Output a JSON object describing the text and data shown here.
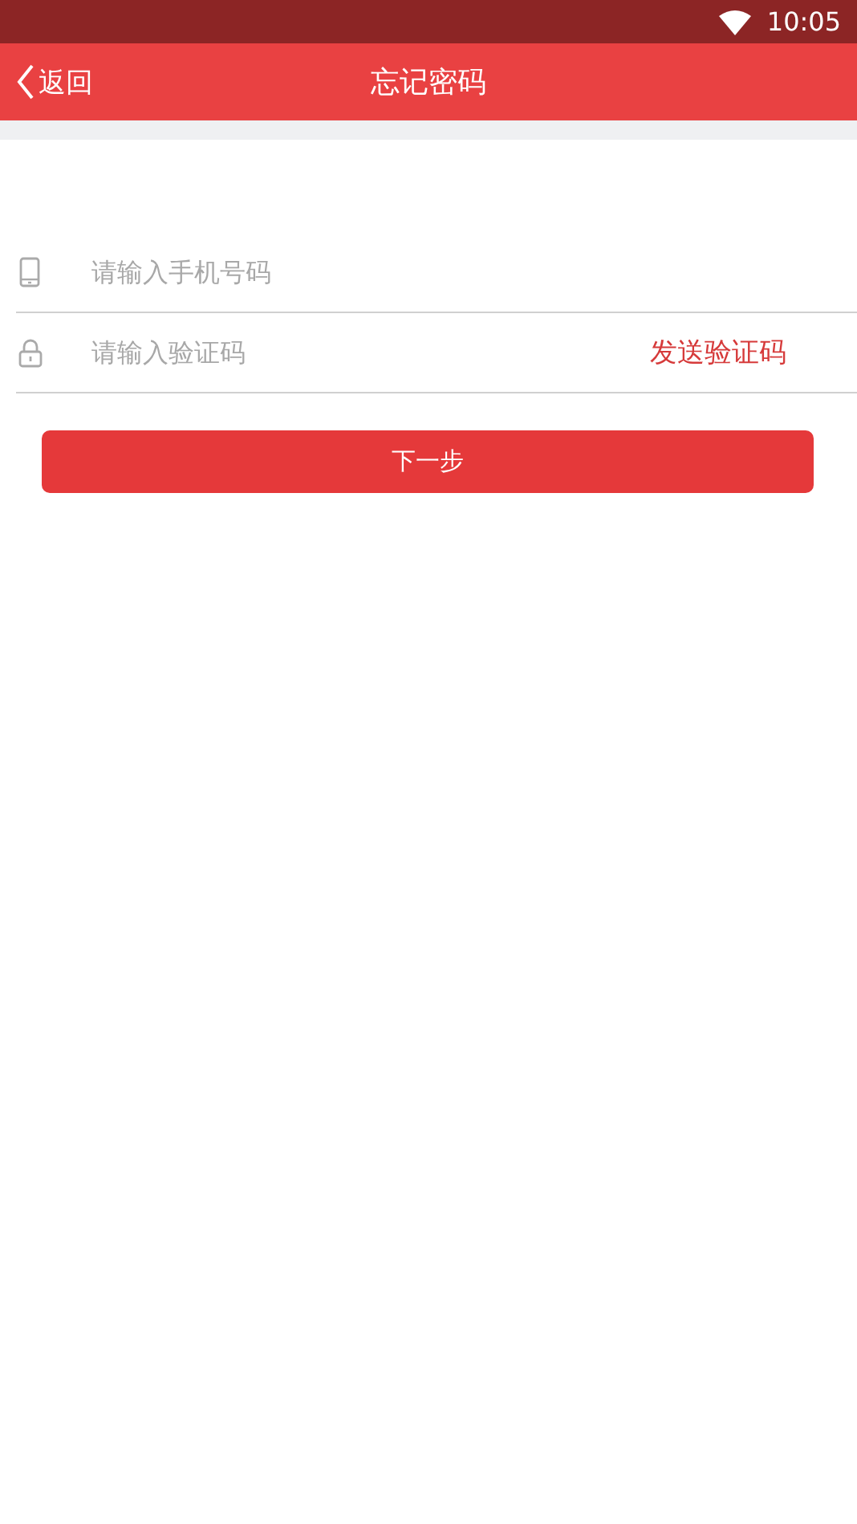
{
  "status_bar": {
    "time": "10:05"
  },
  "header": {
    "back_label": "返回",
    "title": "忘记密码"
  },
  "fields": [
    {
      "kind": "phone",
      "placeholder": "请输入手机号码"
    },
    {
      "kind": "lock",
      "placeholder": "请输入验证码",
      "action": "发送验证码"
    }
  ],
  "submit_button": "下一步"
}
